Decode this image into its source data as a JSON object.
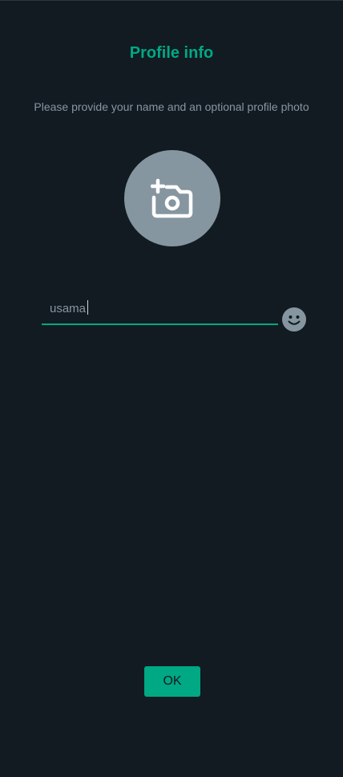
{
  "header": {
    "title": "Profile info",
    "subtitle": "Please provide your name and an optional profile photo"
  },
  "photo": {
    "icon": "add-photo-icon"
  },
  "name_field": {
    "value": "usama",
    "emoji_icon": "smiley-icon"
  },
  "actions": {
    "ok_label": "OK"
  },
  "colors": {
    "background": "#121b22",
    "accent": "#00a884",
    "muted": "#8696a0"
  }
}
